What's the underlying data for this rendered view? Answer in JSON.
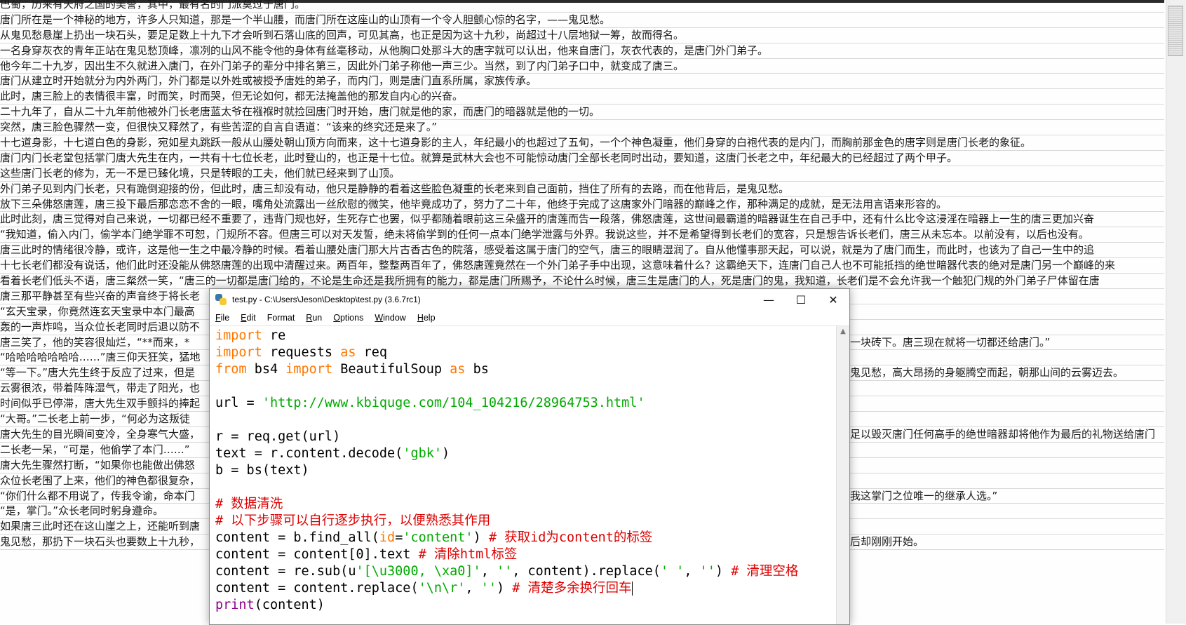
{
  "background_editor": {
    "lines": [
      "巴蜀，历来有天府之国的美誉，其中，最有名的门派莫过于唐门。",
      "唐门所在是一个神秘的地方，许多人只知道，那是一个半山腰，而唐门所在这座山的山顶有一个令人胆颤心惊的名字，——鬼见愁。",
      "从鬼见愁悬崖上扔出一块石头，要足足数上十九下才会听到石落山底的回声，可见其高，也正是因为这十九秒，尚超过十八层地狱一筹，故而得名。",
      "一名身穿灰衣的青年正站在鬼见愁顶峰，凛冽的山风不能令他的身体有丝毫移动，从他胸口处那斗大的唐字就可以认出，他来自唐门，灰衣代表的，是唐门外门弟子。",
      "他今年二十九岁，因出生不久就进入唐门，在外门弟子的辈分中排名第三，因此外门弟子称他一声三少。当然，到了内门弟子口中，就变成了唐三。",
      "唐门从建立时开始就分为内外两门，外门都是以外姓或被授予唐姓的弟子，而内门，则是唐门直系所属，家族传承。",
      "此时，唐三脸上的表情很丰富，时而笑，时而哭，但无论如何，都无法掩盖他的那发自内心的兴奋。",
      "二十九年了，自从二十九年前他被外门长老唐蓝太爷在襁褓时就捡回唐门时开始，唐门就是他的家，而唐门的暗器就是他的一切。",
      "突然，唐三脸色骤然一变，但很快又释然了，有些苦涩的自言自语道：“该来的终究还是来了。”",
      "十七道身影，十七道白色的身影，宛如星丸跳跃一般从山腰处朝山顶方向而来，这十七道身影的主人，年纪最小的也超过了五旬，一个个神色凝重，他们身穿的白袍代表的是内门，而胸前那金色的唐字则是唐门长老的象征。",
      "唐门内门长老堂包括掌门唐大先生在内，一共有十七位长老，此时登山的，也正是十七位。就算是武林大会也不可能惊动唐门全部长老同时出动，要知道，这唐门长老之中，年纪最大的已经超过了两个甲子。",
      "这些唐门长老的修为，无一不是已臻化境，只是转眼的工夫，他们就已经来到了山顶。",
      "外门弟子见到内门长老，只有跪倒迎接的份，但此时，唐三却没有动，他只是静静的看着这些脸色凝重的长老来到自己面前，挡住了所有的去路，而在他背后，是鬼见愁。",
      "放下三朵佛怒唐莲，唐三投下最后那恋恋不舍的一眼，嘴角处流露出一丝欣慰的微笑，他毕竟成功了，努力了二十年，他终于完成了这唐家外门暗器的巅峰之作，那种满足的成就，是无法用言语来形容的。",
      "此时此刻，唐三觉得对自己来说，一切都已经不重要了，违背门规也好，生死存亡也罢，似乎都随着眼前这三朵盛开的唐莲而告一段落，佛怒唐莲，这世间最霸道的暗器诞生在自己手中，还有什么比令这浸淫在暗器上一生的唐三更加兴奋",
      "“我知道，偷入内门，偷学本门绝学罪不可恕，门规所不容。但唐三可以对天发誓，绝未将偷学到的任何一点本门绝学泄露与外界。我说这些，并不是希望得到长老们的宽容，只是想告诉长老们，唐三从未忘本。以前没有，以后也没有。",
      "唐三此时的情绪很冷静，或许，这是他一生之中最冷静的时候。看着山腰处唐门那大片古香古色的院落，感受着这属于唐门的空气，唐三的眼睛湿润了。自从他懂事那天起，可以说，就是为了唐门而生，而此时，也该为了自己一生中的追",
      "十七长老们都没有说话，他们此时还没能从佛怒唐莲的出现中清醒过来。两百年，整整两百年了，佛怒唐莲竟然在一个外门弟子手中出现，这意味着什么？这霸绝天下，连唐门自己人也不可能抵挡的绝世暗器代表的绝对是唐门另一个巅峰的来",
      "看着长老们低头不语，唐三粲然一笑，“唐三的一切都是唐门给的，不论是生命还是我所拥有的能力，都是唐门所赐予，不论什么时候，唐三生是唐门的人，死是唐门的鬼，我知道，长老们是不会允许我一个触犯门规的外门弟子尸体留在唐",
      "唐三那平静甚至有些兴奋的声音终于将长老",
      "“玄天宝录，你竟然连玄天宝录中本门最高",
      "轰的一声炸鸣，当众位长老同时后退以防不",
      "唐三笑了，他的笑容很灿烂，“**而来，*",
      "“哈哈哈哈哈哈哈……”唐三仰天狂笑，猛地",
      "“等一下。”唐大先生终于反应了过来，但是",
      "云雾很浓，带着阵阵湿气，带走了阳光，也",
      "时间似乎已停滞，唐大先生双手颤抖的捧起",
      "“大哥。”二长老上前一步，“何必为这叛徒",
      "唐大先生的目光瞬间变冷，全身寒气大盛，",
      "二长老一呆，“可是，他偷学了本门……”",
      "唐大先生骤然打断，“如果你也能做出佛怒",
      "众位长老围了上来，他们的神色都很复杂，",
      "“你们什么都不用说了，传我令谕，命本门",
      "“是，掌门。”众长老同时躬身遵命。",
      "如果唐三此时还在这山崖之上，还能听到唐",
      "鬼见愁，那扔下一块石头也要数上十九秒，"
    ],
    "right_fragments": [
      {
        "row": 22,
        "text": "一块砖下。唐三现在就将一切都还给唐门。”"
      },
      {
        "row": 24,
        "text": "鬼见愁，高大昂扬的身躯腾空而起，朝那山间的云雾迈去。"
      },
      {
        "row": 28,
        "text": "足以毁灭唐门任何高手的绝世暗器却将他作为最后的礼物送给唐门"
      },
      {
        "row": 32,
        "text": "我这掌门之位唯一的继承人选。”"
      },
      {
        "row": 35,
        "text": "后却刚刚开始。"
      }
    ]
  },
  "idle_window": {
    "title": "test.py - C:\\Users\\Jeson\\Desktop\\test.py (3.6.7rc1)",
    "window_buttons": {
      "minimize": "—",
      "maximize": "☐",
      "close": "✕"
    },
    "menus": [
      {
        "underline": "F",
        "rest": "ile"
      },
      {
        "underline": "E",
        "rest": "dit"
      },
      {
        "underline": "F",
        "rest": "ormat",
        "prefix": ""
      },
      {
        "underline": "R",
        "rest": "un"
      },
      {
        "underline": "O",
        "rest": "ptions"
      },
      {
        "underline": "W",
        "rest": "indow"
      },
      {
        "underline": "H",
        "rest": "elp"
      }
    ],
    "code": {
      "l1_kw": "import",
      "l1_rest": " re",
      "l2_kw": "import",
      "l2_mid": " requests ",
      "l2_kw2": "as",
      "l2_rest": " req",
      "l3_kw": "from",
      "l3_mid": " bs4 ",
      "l3_kw2": "import",
      "l3_mid2": " BeautifulSoup ",
      "l3_kw3": "as",
      "l3_rest": " bs",
      "l5_pre": "url = ",
      "l5_str": "'http://www.kbiquge.com/104_104216/28964753.html'",
      "l7": "r = req.get(url)",
      "l8_pre": "text = r.content.decode(",
      "l8_str": "'gbk'",
      "l8_post": ")",
      "l9": "b = bs(text)",
      "l11": "# 数据清洗",
      "l12": "# 以下步骤可以自行逐步执行，以便熟悉其作用",
      "l13_pre": "content = b.find_all(",
      "l13_kw": "id",
      "l13_eq": "=",
      "l13_str": "'content'",
      "l13_post": ") ",
      "l13_cmt": "# 获取id为content的标签",
      "l14_pre": "content = content[0].text ",
      "l14_cmt": "# 清除html标签",
      "l15_pre": "content = re.sub(u",
      "l15_str": "'[\\u3000, \\xa0]'",
      "l15_mid": ", ",
      "l15_str2": "''",
      "l15_mid2": ", content).replace(",
      "l15_str3": "' '",
      "l15_mid3": ", ",
      "l15_str4": "''",
      "l15_post": ") ",
      "l15_cmt": "# 清理空格",
      "l16_pre": "content = content.replace(",
      "l16_str": "'\\n\\r'",
      "l16_mid": ", ",
      "l16_str2": "''",
      "l16_post": ") ",
      "l16_cmt": "# 清楚多余换行回车",
      "l17_bi": "print",
      "l17_rest": "(content)"
    },
    "colors": {
      "keyword": "#ff7700",
      "string": "#00aa00",
      "comment": "#dd0000",
      "builtin": "#900090"
    }
  }
}
